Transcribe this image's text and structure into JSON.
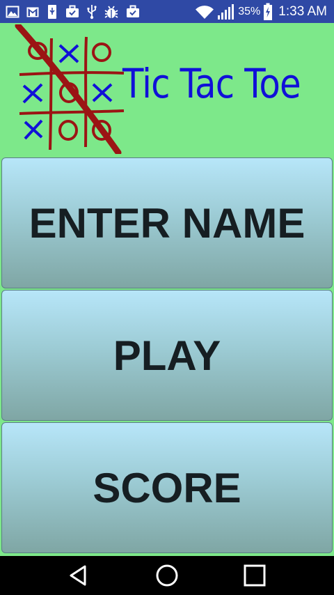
{
  "status_bar": {
    "battery_percent": "35%",
    "time": "1:33 AM",
    "left_icons": [
      "image-icon",
      "gmail-icon",
      "usb-storage-icon",
      "briefcase-icon",
      "usb-icon",
      "bug-icon",
      "briefcase-check-icon"
    ],
    "right_icons": [
      "wifi-icon",
      "signal-icon",
      "battery-charging-icon"
    ],
    "background_color": "#2f49a5"
  },
  "header": {
    "title": "Tic Tac Toe",
    "logo_icon": "tic-tac-toe-logo",
    "background_color": "#7de88a",
    "title_color": "#1010d8"
  },
  "menu": {
    "buttons": [
      {
        "label": "ENTER NAME"
      },
      {
        "label": "PLAY"
      },
      {
        "label": "SCORE"
      }
    ]
  },
  "nav_bar": {
    "icons": [
      "back-icon",
      "home-icon",
      "recents-icon"
    ]
  }
}
